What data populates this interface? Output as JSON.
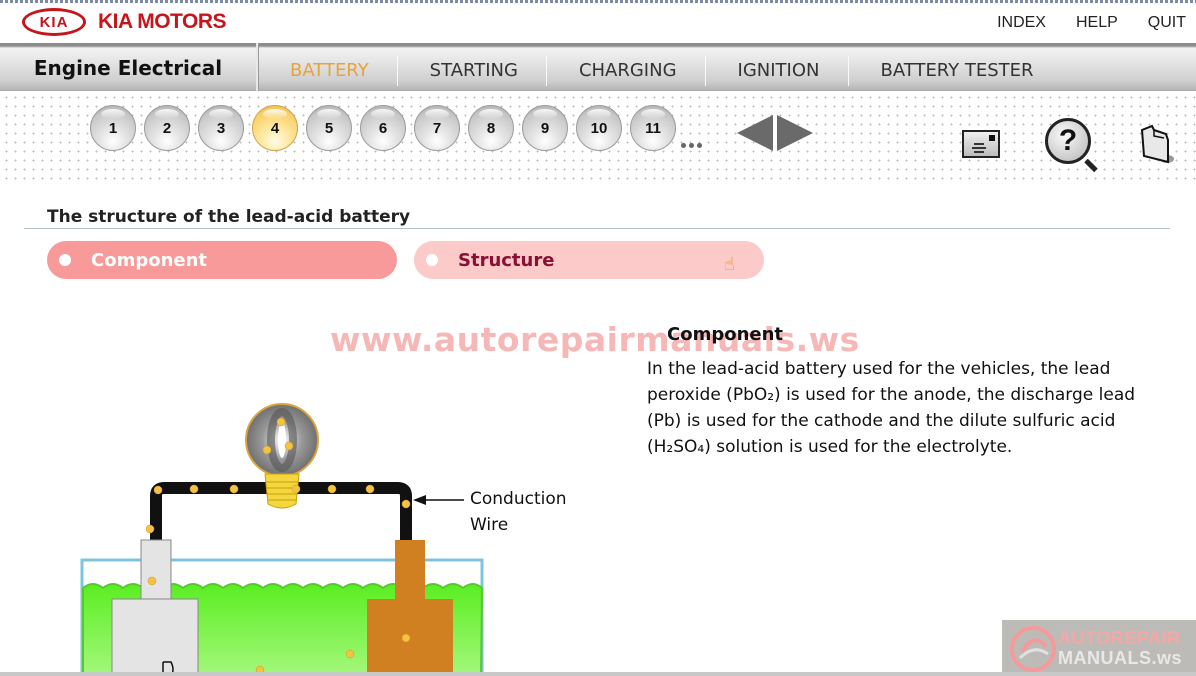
{
  "brand": {
    "logo_mark": "KIA",
    "name": "KIA MOTORS"
  },
  "top_links": [
    "INDEX",
    "HELP",
    "QUIT"
  ],
  "nav": {
    "section": "Engine Electrical",
    "tabs": [
      {
        "label": "BATTERY",
        "active": true
      },
      {
        "label": "STARTING",
        "active": false
      },
      {
        "label": "CHARGING",
        "active": false
      },
      {
        "label": "IGNITION",
        "active": false
      },
      {
        "label": "BATTERY TESTER",
        "active": false
      }
    ]
  },
  "pagination": {
    "pages": [
      "1",
      "2",
      "3",
      "4",
      "5",
      "6",
      "7",
      "8",
      "9",
      "10",
      "11"
    ],
    "current": "4",
    "more_indicator": "..."
  },
  "toolbar_icons": [
    "mail-icon",
    "help-search-icon",
    "folder-icon"
  ],
  "content": {
    "section_title": "The structure of the lead-acid battery",
    "tabs": [
      {
        "label": "Component",
        "active": true
      },
      {
        "label": "Structure",
        "active": false
      }
    ],
    "watermark": "www.autorepairmanuals.ws",
    "info_title": "Component",
    "info_body": "In the lead-acid battery used for the vehicles, the lead peroxide (PbO₂) is used for the anode, the discharge lead (Pb) is used for the cathode and the dilute sulfuric acid (H₂SO₄) solution is used for the electrolyte.",
    "diagram": {
      "label_line1": "Conduction",
      "label_line2": "Wire",
      "colors": {
        "electrolyte": "#66f033",
        "anode": "#d08020",
        "cathode": "#e4e4e4",
        "wire": "#111111",
        "electron": "#f5c242"
      }
    }
  },
  "badge": {
    "line1": "AUTOREPAIR",
    "line2": "MANUALS.ws"
  },
  "colors": {
    "brand_red": "#c4161c",
    "active_tab": "#e8a23a",
    "pill_active": "#f99a9a",
    "pill_inactive": "#fdcaca",
    "pill_inactive_text": "#8a0f35"
  }
}
